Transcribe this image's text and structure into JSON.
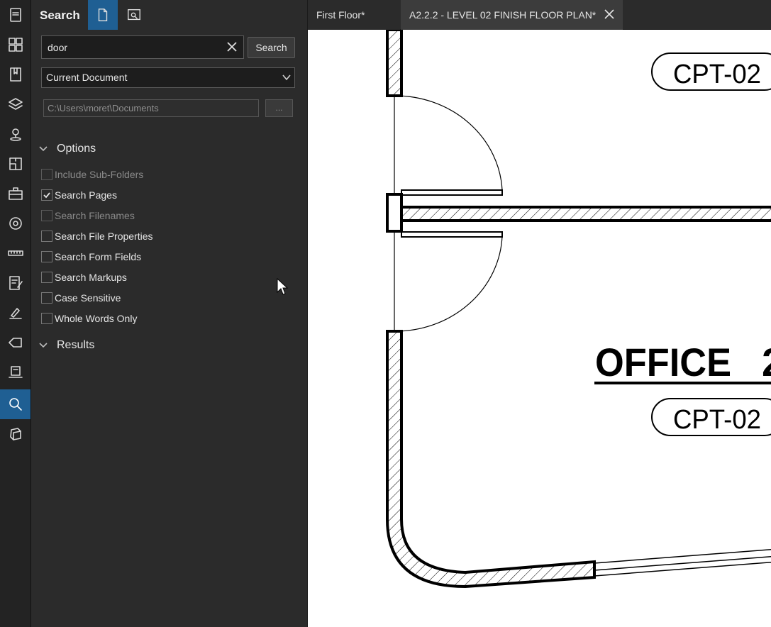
{
  "panel": {
    "title": "Search",
    "search_value": "door",
    "search_button": "Search",
    "scope": "Current Document",
    "path": "C:\\Users\\moret\\Documents",
    "browse": "...",
    "options_header": "Options",
    "results_header": "Results",
    "options": [
      {
        "label": "Include Sub-Folders",
        "checked": false,
        "enabled": false
      },
      {
        "label": "Search Pages",
        "checked": true,
        "enabled": true
      },
      {
        "label": "Search Filenames",
        "checked": false,
        "enabled": false
      },
      {
        "label": "Search File Properties",
        "checked": false,
        "enabled": true
      },
      {
        "label": "Search Form Fields",
        "checked": false,
        "enabled": true
      },
      {
        "label": "Search Markups",
        "checked": false,
        "enabled": true
      },
      {
        "label": "Case Sensitive",
        "checked": false,
        "enabled": true
      },
      {
        "label": "Whole Words Only",
        "checked": false,
        "enabled": true
      }
    ]
  },
  "tabs": [
    {
      "label": "First Floor*",
      "active": false
    },
    {
      "label": "A2.2.2 - LEVEL 02 FINISH FLOOR PLAN*",
      "active": true
    }
  ],
  "drawing": {
    "tag_top": "CPT-02",
    "room_name": "OFFICE",
    "room_number_partial": "2",
    "tag_bottom": "CPT-02"
  },
  "colors": {
    "accent": "#1f5f93",
    "panel_bg": "#2b2b2b",
    "rail_bg": "#232323"
  }
}
